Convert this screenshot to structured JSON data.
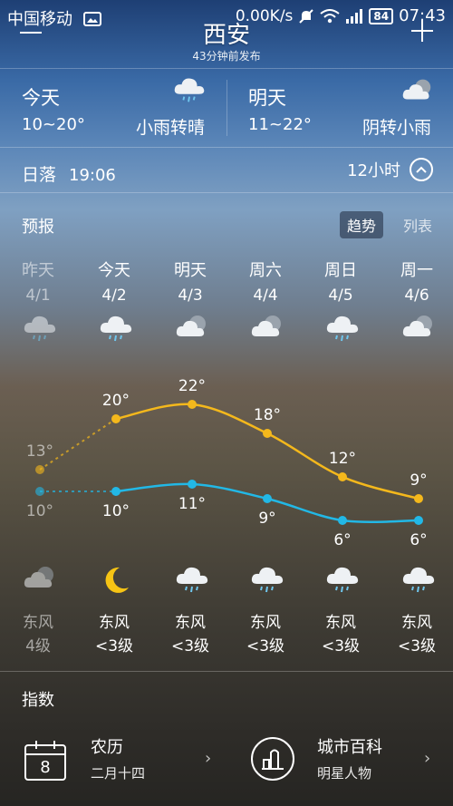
{
  "status_bar": {
    "carrier": "中国移动",
    "speed": "0.00K/s",
    "battery": "84",
    "time": "07:43"
  },
  "header": {
    "city": "西安",
    "published": "43分钟前发布"
  },
  "today": {
    "label": "今天",
    "temp": "10~20°",
    "desc": "小雨转晴"
  },
  "tomorrow": {
    "label": "明天",
    "temp": "11~22°",
    "desc": "阴转小雨"
  },
  "sun": {
    "label": "日落",
    "time": "19:06",
    "hours": "12小时"
  },
  "forecast": {
    "title": "预报",
    "view_trend": "趋势",
    "view_list": "列表",
    "days": [
      {
        "name": "昨天",
        "date": "4/1",
        "high": "13°",
        "low": "10°",
        "day_icon": "cloudy-rain-icon",
        "night_icon": "cloudy-icon",
        "wind": "东风",
        "level": "4级"
      },
      {
        "name": "今天",
        "date": "4/2",
        "high": "20°",
        "low": "10°",
        "day_icon": "cloudy-rain-icon",
        "night_icon": "moon-icon",
        "wind": "东风",
        "level": "<3级"
      },
      {
        "name": "明天",
        "date": "4/3",
        "high": "22°",
        "low": "11°",
        "day_icon": "cloudy-icon",
        "night_icon": "cloudy-rain-icon",
        "wind": "东风",
        "level": "<3级"
      },
      {
        "name": "周六",
        "date": "4/4",
        "high": "18°",
        "low": "9°",
        "day_icon": "cloudy-icon",
        "night_icon": "cloudy-rain-icon",
        "wind": "东风",
        "level": "<3级"
      },
      {
        "name": "周日",
        "date": "4/5",
        "high": "12°",
        "low": "6°",
        "day_icon": "cloudy-rain-icon",
        "night_icon": "cloudy-rain-icon",
        "wind": "东风",
        "level": "<3级"
      },
      {
        "name": "周一",
        "date": "4/6",
        "high": "9°",
        "low": "6°",
        "day_icon": "cloudy-icon",
        "night_icon": "cloudy-rain-icon",
        "wind": "东风",
        "level": "<3级"
      }
    ]
  },
  "chart_data": {
    "type": "line",
    "categories": [
      "4/1",
      "4/2",
      "4/3",
      "4/4",
      "4/5",
      "4/6"
    ],
    "series": [
      {
        "values": [
          13,
          20,
          22,
          18,
          12,
          9
        ],
        "color": "#f4b81c"
      },
      {
        "values": [
          10,
          10,
          11,
          9,
          6,
          6
        ],
        "color": "#22b8e6"
      }
    ],
    "ylim": [
      4,
      24
    ],
    "grid": false
  },
  "index": {
    "title": "指数",
    "items": [
      {
        "title": "农历",
        "sub": "二月十四",
        "icon": "calendar-icon",
        "icon_text": "8"
      },
      {
        "title": "城市百科",
        "sub": "明星人物",
        "icon": "building-icon"
      }
    ]
  }
}
